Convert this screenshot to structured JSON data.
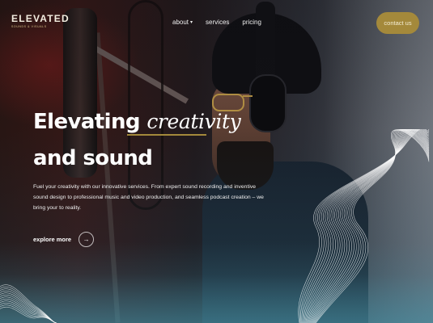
{
  "brand": {
    "name": "ELEVATED",
    "tagline": "SOUNDS & VISUALS"
  },
  "nav": {
    "items": [
      {
        "label": "about",
        "has_dropdown": true
      },
      {
        "label": "services",
        "has_dropdown": false
      },
      {
        "label": "pricing",
        "has_dropdown": false
      }
    ],
    "cta_label": "contact us"
  },
  "hero": {
    "title_line1_bold": "Elevating ",
    "title_line1_italic": "creativity",
    "title_line2": "and sound",
    "description": "Fuel your creativity with our innovative services. From expert sound recording and inventive sound design to professional music and video production, and seamless podcast creation – we bring your to reality.",
    "explore_label": "explore more"
  },
  "colors": {
    "accent": "#a4893b",
    "text": "#ffffff"
  },
  "icons": {
    "arrow": "arrow-right-icon",
    "dropdown": "chevron-down-icon"
  }
}
